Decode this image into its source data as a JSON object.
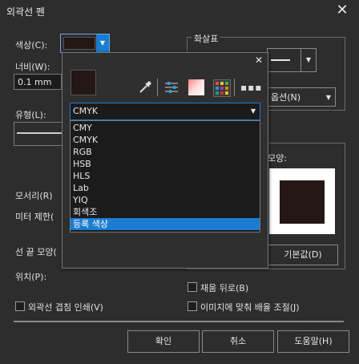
{
  "window": {
    "title": "외곽선 펜"
  },
  "labels": {
    "color": "색상(C):",
    "width": "너비(W):",
    "style": "유형(L):",
    "corners": "모서리(R)",
    "miter": "미터 제한(",
    "line_caps": "선 끝 모양(",
    "position": "위치(P):",
    "arrows": "화살표",
    "options": "옵션(N)",
    "calligraphy_shape": "모양:",
    "behind_fill": "채움 뒤로(B)",
    "scale_with_image": "이미지에 맞춰 배율 조절(J)",
    "overprint_outline": "외곽선 겹침 인쇄(V)"
  },
  "inputs": {
    "width_value": "0.1 mm"
  },
  "buttons": {
    "ok": "확인",
    "cancel": "취소",
    "help": "도움말(H)",
    "default": "기본값(D)"
  },
  "color_popup": {
    "selected_model": "CMYK",
    "models": [
      "CMY",
      "CMYK",
      "RGB",
      "HSB",
      "HLS",
      "Lab",
      "YIQ",
      "회색조",
      "등록 색상"
    ],
    "highlighted_model": "등록 색상",
    "swatch_color": "#231815"
  },
  "colors": {
    "accent": "#1b7dd1",
    "background": "#2d2d2d",
    "swatch": "#231815"
  },
  "icons": [
    "close-icon",
    "dropdown-arrow-icon",
    "eyedropper-icon",
    "color-sliders-icon",
    "color-viewer-icon",
    "color-palette-icon",
    "more-options-icon"
  ]
}
